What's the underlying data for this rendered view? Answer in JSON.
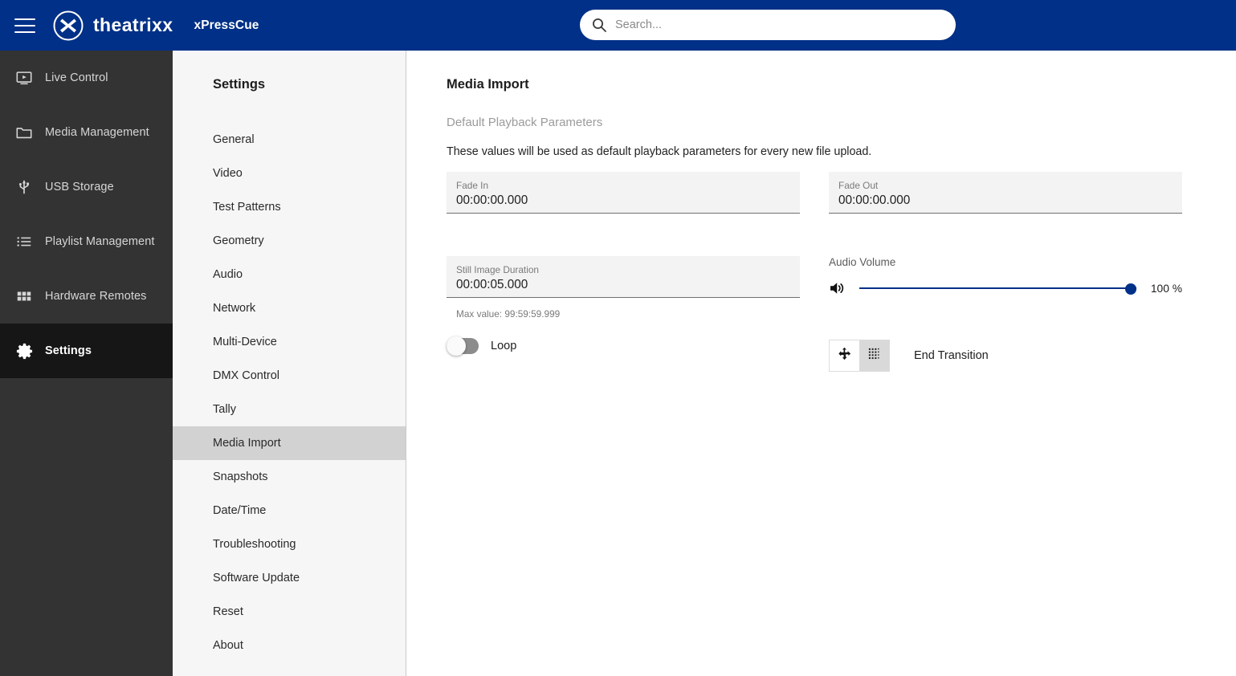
{
  "header": {
    "menu_icon": "hamburger-icon",
    "logo_icon": "theatrixx-logo-icon",
    "brand": "theatrixx",
    "app_name": "xPressCue",
    "search": {
      "icon": "search-icon",
      "value": "",
      "placeholder": "Search..."
    },
    "background_color": "#003087"
  },
  "sidebar": {
    "background_color": "#333333",
    "active_color": "#161616",
    "items": [
      {
        "label": "Live Control",
        "icon": "monitor-play-icon",
        "active": false
      },
      {
        "label": "Media Management",
        "icon": "folder-icon",
        "active": false
      },
      {
        "label": "USB Storage",
        "icon": "usb-icon",
        "active": false
      },
      {
        "label": "Playlist Management",
        "icon": "list-icon",
        "active": false
      },
      {
        "label": "Hardware Remotes",
        "icon": "grid-blocks-icon",
        "active": false
      },
      {
        "label": "Settings",
        "icon": "gear-icon",
        "active": true
      }
    ]
  },
  "settings_pane": {
    "title": "Settings",
    "background_color": "#f6f6f6",
    "active_color": "#d2d2d2",
    "items": [
      {
        "label": "General",
        "active": false
      },
      {
        "label": "Video",
        "active": false
      },
      {
        "label": "Test Patterns",
        "active": false
      },
      {
        "label": "Geometry",
        "active": false
      },
      {
        "label": "Audio",
        "active": false
      },
      {
        "label": "Network",
        "active": false
      },
      {
        "label": "Multi-Device",
        "active": false
      },
      {
        "label": "DMX Control",
        "active": false
      },
      {
        "label": "Tally",
        "active": false
      },
      {
        "label": "Media Import",
        "active": true
      },
      {
        "label": "Snapshots",
        "active": false
      },
      {
        "label": "Date/Time",
        "active": false
      },
      {
        "label": "Troubleshooting",
        "active": false
      },
      {
        "label": "Software Update",
        "active": false
      },
      {
        "label": "Reset",
        "active": false
      },
      {
        "label": "About",
        "active": false
      }
    ]
  },
  "main": {
    "page_title": "Media Import",
    "section_subtitle": "Default Playback Parameters",
    "section_description": "These values will be used as default playback parameters for every new file upload.",
    "fade_in": {
      "label": "Fade In",
      "value": "00:00:00.000",
      "placeholder": "00:00:00.000"
    },
    "fade_out": {
      "label": "Fade Out",
      "value": "00:00:00.000",
      "placeholder": "00:00:00.000"
    },
    "still_image_duration": {
      "label": "Still Image Duration",
      "value": "00:00:05.000",
      "placeholder": "00:00:00.000",
      "hint": "Max value: 99:59:59.999"
    },
    "loop": {
      "label": "Loop",
      "enabled": false
    },
    "audio_volume": {
      "label": "Audio Volume",
      "icon": "speaker-volume-icon",
      "percent_text": "100 %",
      "percent": 100,
      "accent_color": "#003087"
    },
    "end_transition": {
      "label": "End Transition",
      "options": [
        {
          "icon": "move-arrows-icon",
          "selected": false
        },
        {
          "icon": "dotted-grid-icon",
          "selected": true
        }
      ]
    }
  }
}
